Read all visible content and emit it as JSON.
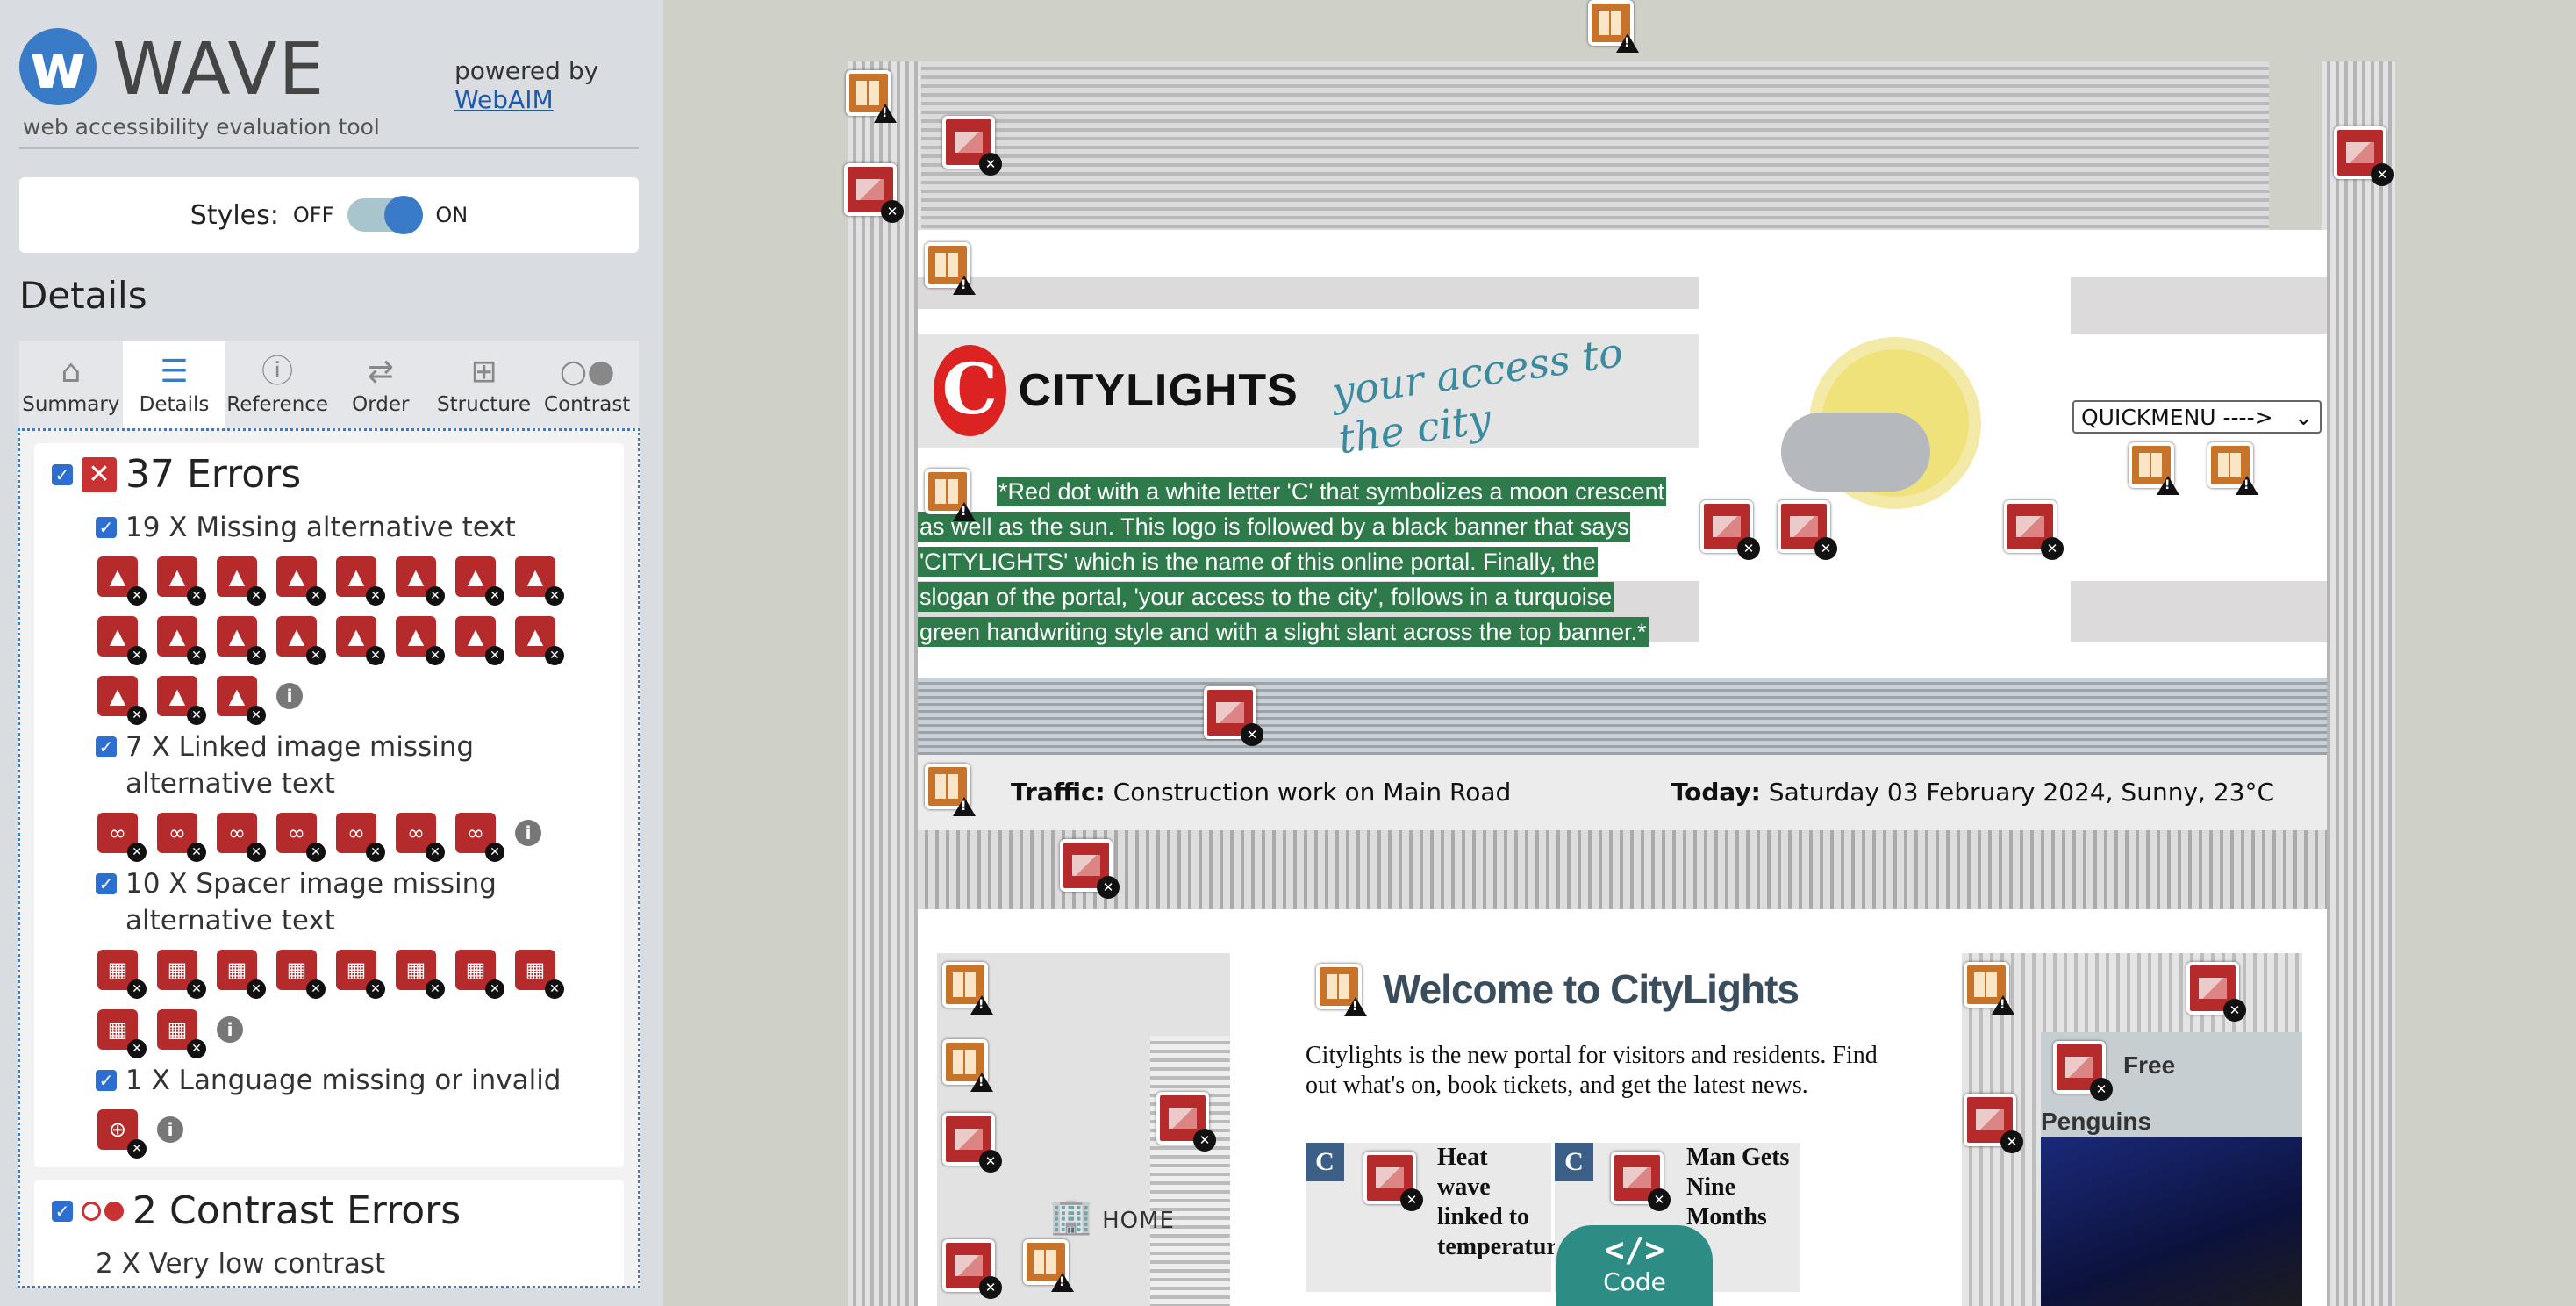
{
  "wave": {
    "title": "WAVE",
    "subtitle": "web accessibility evaluation tool",
    "powered_by": "powered by",
    "webaim": "WebAIM"
  },
  "styles": {
    "label": "Styles:",
    "off": "OFF",
    "on": "ON",
    "state": "on"
  },
  "details_heading": "Details",
  "tabs": [
    {
      "label": "Summary",
      "icon": "home-icon"
    },
    {
      "label": "Details",
      "icon": "list-icon"
    },
    {
      "label": "Reference",
      "icon": "info-icon"
    },
    {
      "label": "Order",
      "icon": "order-icon"
    },
    {
      "label": "Structure",
      "icon": "structure-icon"
    },
    {
      "label": "Contrast",
      "icon": "contrast-icon"
    }
  ],
  "active_tab": "Details",
  "errors": {
    "title": "37 Errors",
    "items": [
      {
        "label": "19 X Missing alternative text",
        "count": 19
      },
      {
        "label": "7 X Linked image missing alternative text",
        "count": 7
      },
      {
        "label": "10 X Spacer image missing alternative text",
        "count": 10
      },
      {
        "label": "1 X Language missing or invalid",
        "count": 1
      }
    ]
  },
  "contrast": {
    "title": "2 Contrast Errors",
    "first_item": "2 X Very low contrast"
  },
  "site": {
    "brand": "CITYLIGHTS",
    "slogan": "your access to the city",
    "quickmenu": "QUICKMENU ---->",
    "alt_lines": [
      "*Red dot with a white letter 'C' that symbolizes a moon crescent",
      "as well as the sun. This logo is followed by a black banner that says",
      "'CITYLIGHTS' which is the name of this online portal. Finally, the",
      "slogan of the portal, 'your access to the city', follows in a turquoise",
      "green handwriting style and with a slight slant across the top banner.*"
    ],
    "traffic_label": "Traffic:",
    "traffic_text": "Construction work on Main Road",
    "today_label": "Today:",
    "today_text": "Saturday 03 February 2024, Sunny, 23°C",
    "home": "HOME",
    "welcome": "Welcome to CityLights",
    "intro": "Citylights is the new portal for visitors and residents. Find out what's on, book tickets, and get the latest news.",
    "news1": "Heat wave linked to temperatures",
    "news2": "Man Gets Nine Months",
    "free": "Free",
    "penguins": "Penguins"
  },
  "code_button": {
    "symbol": "</>",
    "label": "Code"
  },
  "colors": {
    "error": "#b52a2a",
    "warning": "#c7742a",
    "accent": "#3a7bc8",
    "alt_bg": "#2f7a4a",
    "code": "#2d8d85"
  }
}
